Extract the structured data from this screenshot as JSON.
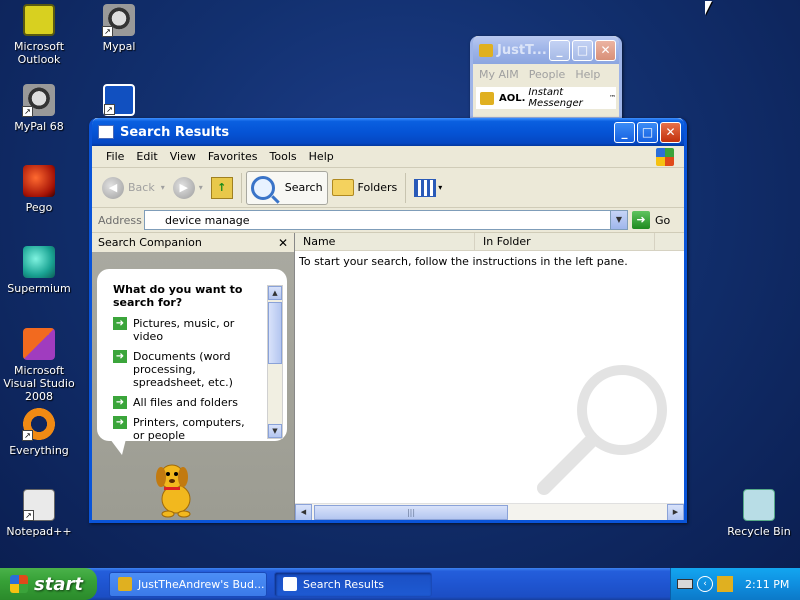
{
  "desktop": {
    "icons": [
      {
        "label": "Microsoft Outlook",
        "icon": "outlook-icon"
      },
      {
        "label": "Mypal",
        "icon": "raccoon-icon"
      },
      {
        "label": "MyPal 68",
        "icon": "raccoon-icon"
      },
      {
        "label": "Pego",
        "icon": "pego-icon"
      },
      {
        "label": "Supermium",
        "icon": "supermium-icon"
      },
      {
        "label": "Microsoft Visual Studio 2008",
        "icon": "visual-studio-icon"
      },
      {
        "label": "Everything",
        "icon": "everything-icon"
      },
      {
        "label": "Notepad++",
        "icon": "notepad-plus-plus-icon"
      },
      {
        "label": "Recycle Bin",
        "icon": "recycle-bin-icon"
      }
    ]
  },
  "aim_window": {
    "title": "JustT...",
    "menu": [
      "My AIM",
      "People",
      "Help"
    ],
    "banner_brand": "AOL.",
    "banner_product": "Instant Messenger",
    "banner_tm": "™"
  },
  "search_window": {
    "title": "Search Results",
    "menu": [
      "File",
      "Edit",
      "View",
      "Favorites",
      "Tools",
      "Help"
    ],
    "toolbar": {
      "back": "Back",
      "search": "Search",
      "folders": "Folders"
    },
    "address": {
      "label": "Address",
      "value": "device manage",
      "go": "Go"
    },
    "companion": {
      "header": "Search Companion",
      "close": "✕",
      "question": "What do you want to search for?",
      "options": [
        "Pictures, music, or video",
        "Documents (word processing, spreadsheet, etc.)",
        "All files and folders",
        "Printers, computers, or people"
      ]
    },
    "results": {
      "columns": [
        "Name",
        "In Folder"
      ],
      "message": "To start your search, follow the instructions in the left pane."
    }
  },
  "taskbar": {
    "start": "start",
    "tasks": [
      {
        "label": "JustTheAndrew's Bud...",
        "active": false
      },
      {
        "label": "Search Results",
        "active": true
      }
    ],
    "clock": "2:11 PM"
  },
  "colors": {
    "titlebar_blue": "#0554d6",
    "start_green": "#37a137",
    "tray_blue": "#0f8fe0"
  }
}
